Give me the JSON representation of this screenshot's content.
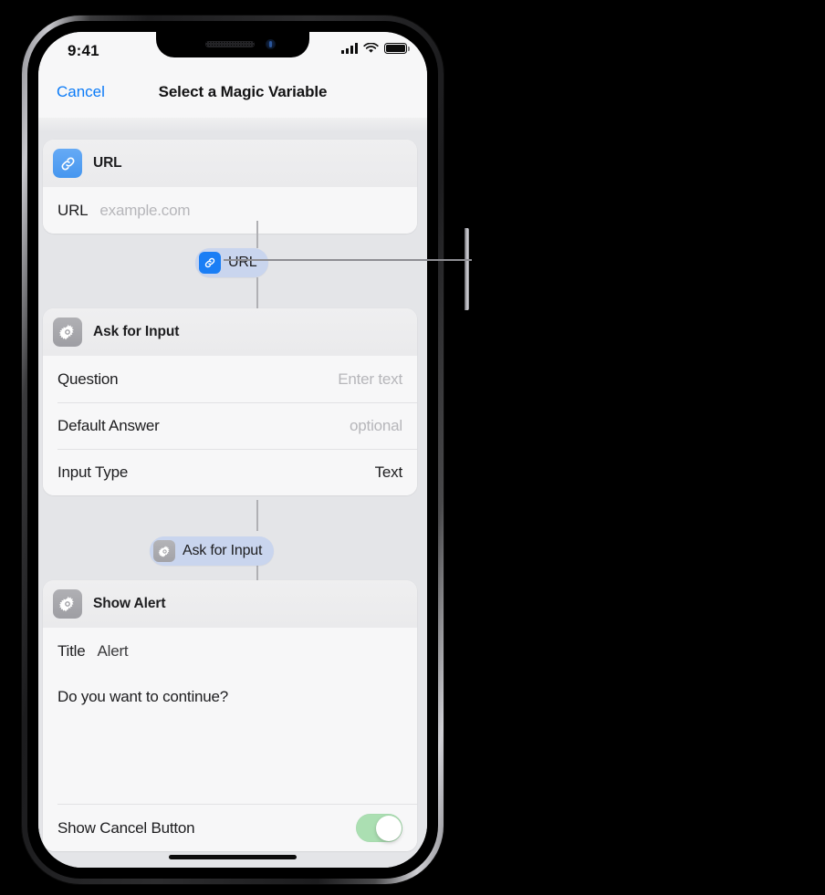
{
  "status_bar": {
    "time": "9:41",
    "icons": [
      "cellular-signal-icon",
      "wifi-icon",
      "battery-icon"
    ]
  },
  "nav_bar": {
    "cancel_label": "Cancel",
    "title": "Select a Magic Variable"
  },
  "cards": [
    {
      "id": "url-action",
      "icon": "link-icon",
      "icon_color": "#4596ef",
      "title": "URL",
      "rows": [
        {
          "label": "URL",
          "value": "example.com",
          "value_is_placeholder": true
        }
      ]
    },
    {
      "id": "ask-for-input-action",
      "icon": "gear-icon",
      "icon_color": "#9e9ea3",
      "title": "Ask for Input",
      "rows": [
        {
          "label": "Question",
          "value": "Enter text",
          "value_is_placeholder": true
        },
        {
          "label": "Default Answer",
          "value": "optional",
          "value_is_placeholder": true
        },
        {
          "label": "Input Type",
          "value": "Text",
          "value_is_placeholder": false
        }
      ]
    },
    {
      "id": "show-alert-action",
      "icon": "gear-icon",
      "icon_color": "#9e9ea3",
      "title": "Show Alert",
      "title_row": {
        "label": "Title",
        "value": "Alert"
      },
      "message": "Do you want to continue?",
      "toggle_row": {
        "label": "Show Cancel Button",
        "state": "on",
        "color": "#abdfb2"
      }
    }
  ],
  "variable_pills": [
    {
      "id": "url-variable-pill",
      "icon": "link-icon",
      "label": "URL",
      "color": "#c9d5ee"
    },
    {
      "id": "ask-for-input-variable-pill",
      "icon": "gear-icon",
      "label": "Ask for Input",
      "color": "#c9d5ee"
    }
  ],
  "colors": {
    "accent_blue": "#0b7bf7",
    "background": "#e4e5e8",
    "card": "#f7f7f8",
    "pill": "#c9d5ee",
    "toggle_on": "#abdfb2"
  }
}
